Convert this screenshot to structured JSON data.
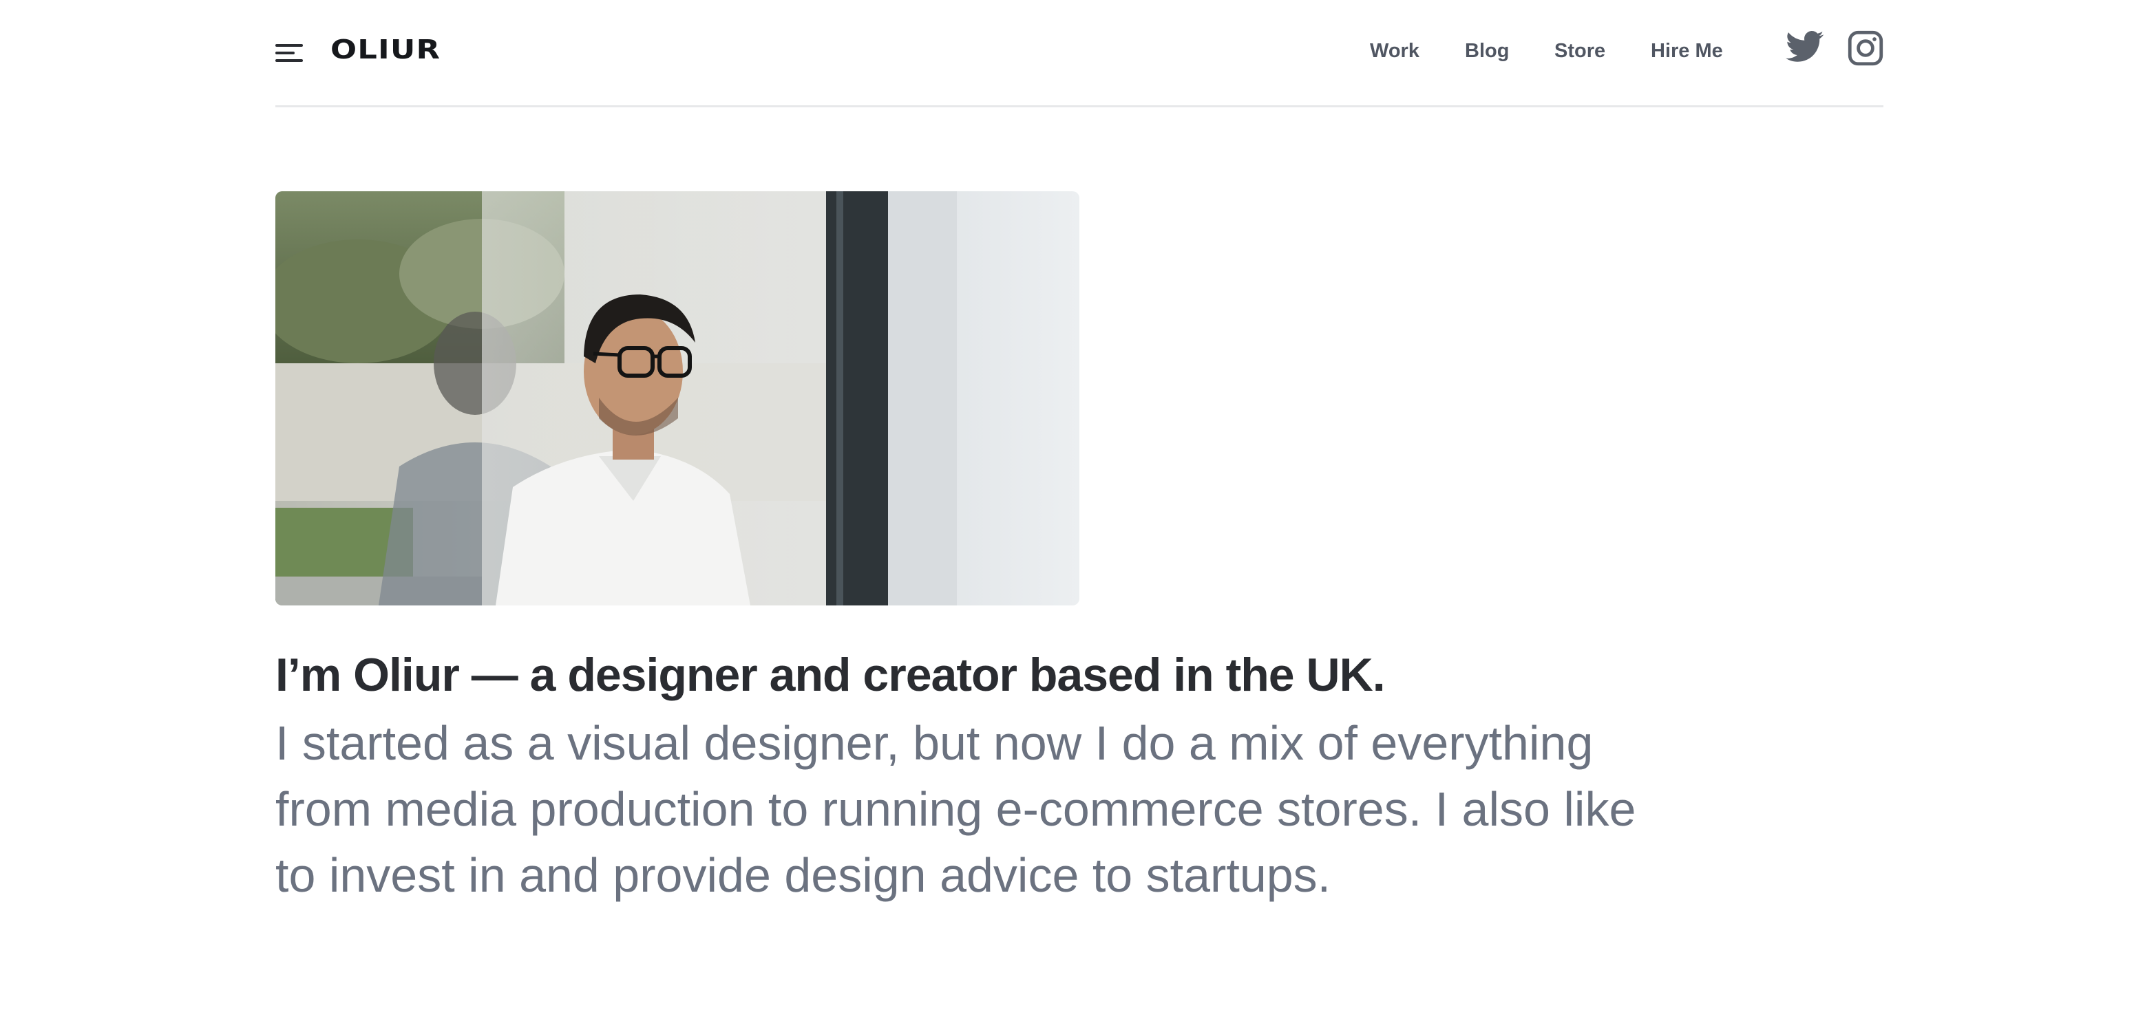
{
  "header": {
    "menu_icon": "hamburger-menu-icon",
    "logo": "OLIUR",
    "nav": {
      "work": "Work",
      "blog": "Blog",
      "store": "Store",
      "hire_me": "Hire Me"
    },
    "social": {
      "twitter_icon": "twitter-icon",
      "instagram_icon": "instagram-icon"
    }
  },
  "main": {
    "intro_heading": "I’m Oliur — a designer and creator based in the UK.",
    "intro_body": "I started as a visual designer, but now I do a mix of everything from media production to running e-commerce stores. I also like to invest in and provide design advice to startups."
  },
  "colors": {
    "background": "#ffffff",
    "heading": "#2a2c31",
    "body_text": "#6b7280",
    "nav_text": "#505662",
    "divider": "#e7e8ea"
  }
}
